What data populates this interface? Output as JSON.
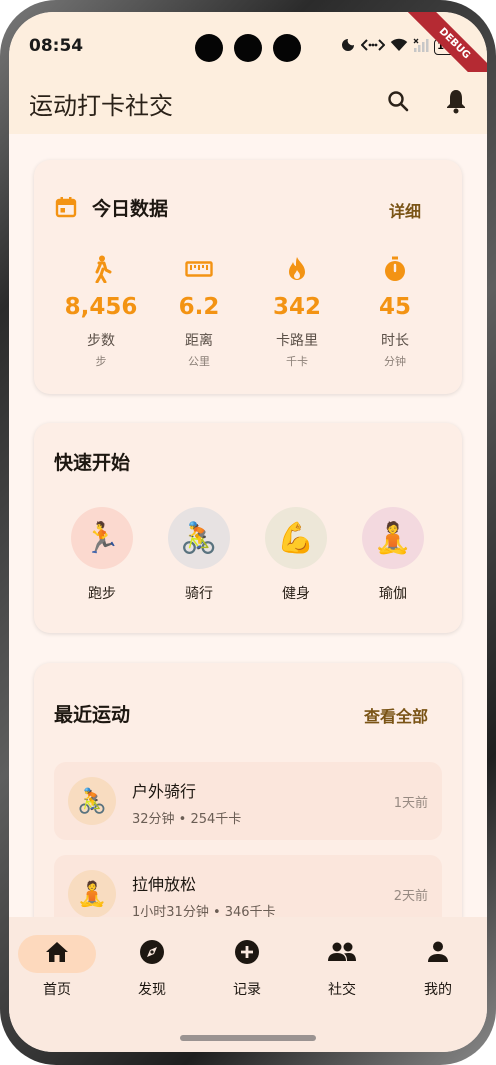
{
  "status_bar": {
    "time": "08:54",
    "battery": "100",
    "debug_label": "DEBUG"
  },
  "app_bar": {
    "title": "运动打卡社交",
    "icons": [
      "search-icon",
      "bell-icon"
    ]
  },
  "colors": {
    "accent": "#f39313",
    "background": "#fff5f0",
    "card": "#fdeee6",
    "link": "#7a5416"
  },
  "today": {
    "title": "今日数据",
    "detail_label": "详细",
    "stats": [
      {
        "icon": "walking-icon",
        "value": "8,456",
        "label": "步数",
        "unit": "步"
      },
      {
        "icon": "ruler-icon",
        "value": "6.2",
        "label": "距离",
        "unit": "公里"
      },
      {
        "icon": "fire-icon",
        "value": "342",
        "label": "卡路里",
        "unit": "千卡"
      },
      {
        "icon": "timer-icon",
        "value": "45",
        "label": "时长",
        "unit": "分钟"
      }
    ]
  },
  "quick_start": {
    "title": "快速开始",
    "items": [
      {
        "emoji": "🏃",
        "label": "跑步"
      },
      {
        "emoji": "🚴",
        "label": "骑行"
      },
      {
        "emoji": "💪",
        "label": "健身"
      },
      {
        "emoji": "🧘",
        "label": "瑜伽"
      }
    ]
  },
  "recent": {
    "title": "最近运动",
    "view_all_label": "查看全部",
    "items": [
      {
        "emoji": "🚴",
        "name": "户外骑行",
        "meta": "32分钟  •  254千卡",
        "when": "1天前"
      },
      {
        "emoji": "🧘",
        "name": "拉伸放松",
        "meta": "1小时31分钟  •  346千卡",
        "when": "2天前"
      }
    ]
  },
  "bottom_nav": {
    "items": [
      {
        "icon": "home-icon",
        "label": "首页",
        "active": true
      },
      {
        "icon": "compass-icon",
        "label": "发现",
        "active": false
      },
      {
        "icon": "add-circle-icon",
        "label": "记录",
        "active": false
      },
      {
        "icon": "people-icon",
        "label": "社交",
        "active": false
      },
      {
        "icon": "person-icon",
        "label": "我的",
        "active": false
      }
    ]
  }
}
